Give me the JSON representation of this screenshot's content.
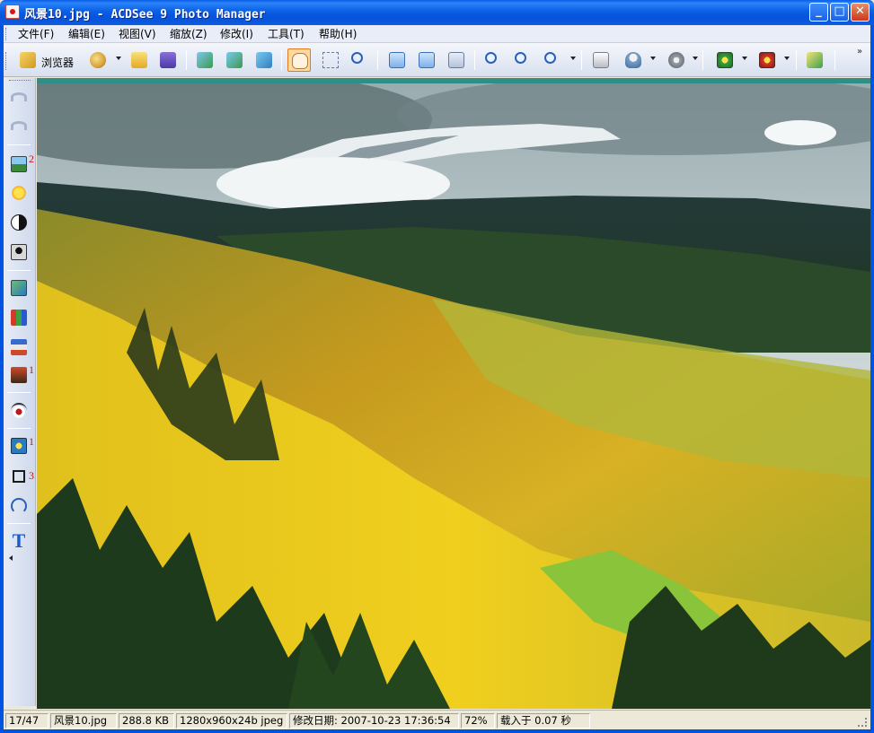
{
  "window": {
    "title": "风景10.jpg - ACDSee 9 Photo Manager",
    "controls": {
      "minimize": "_",
      "maximize": "□",
      "close": "✕"
    }
  },
  "menu": [
    {
      "label": "文件(F)",
      "id": "file"
    },
    {
      "label": "编辑(E)",
      "id": "edit"
    },
    {
      "label": "视图(V)",
      "id": "view"
    },
    {
      "label": "缩放(Z)",
      "id": "zoom"
    },
    {
      "label": "修改(I)",
      "id": "modify"
    },
    {
      "label": "工具(T)",
      "id": "tools"
    },
    {
      "label": "帮助(H)",
      "id": "help"
    }
  ],
  "toolbar": {
    "browser_label": "浏览器",
    "buttons": [
      {
        "icon": "browser-icon"
      },
      {
        "icon": "edit-palette-icon"
      },
      {
        "icon": "open-folder-icon"
      },
      {
        "icon": "save-icon"
      },
      {
        "icon": "previous-image-icon"
      },
      {
        "icon": "next-image-icon"
      },
      {
        "icon": "auto-advance-icon"
      },
      {
        "icon": "hand-pan-icon"
      },
      {
        "icon": "select-icon"
      },
      {
        "icon": "zoom-tool-icon"
      },
      {
        "icon": "rotate-left-icon"
      },
      {
        "icon": "rotate-right-icon"
      },
      {
        "icon": "flip-icon"
      },
      {
        "icon": "zoom-in-icon"
      },
      {
        "icon": "zoom-out-icon"
      },
      {
        "icon": "zoom-menu-icon"
      },
      {
        "icon": "print-icon"
      },
      {
        "icon": "set-wallpaper-icon"
      },
      {
        "icon": "audio-icon"
      },
      {
        "icon": "photo-effect-icon"
      },
      {
        "icon": "photo-frame-icon"
      },
      {
        "icon": "send-icon"
      }
    ]
  },
  "leftbar": {
    "marks": {
      "exposure": "2",
      "gradient": "1",
      "red_eye_fix": "1",
      "crop": "3"
    }
  },
  "status": {
    "index": "17/47",
    "filename": "风景10.jpg",
    "filesize": "288.8 KB",
    "dimensions": "1280x960x24b jpeg",
    "modified": "修改日期: 2007-10-23 17:36:54",
    "zoom": "72%",
    "load_time": "载入于 0.07 秒"
  }
}
